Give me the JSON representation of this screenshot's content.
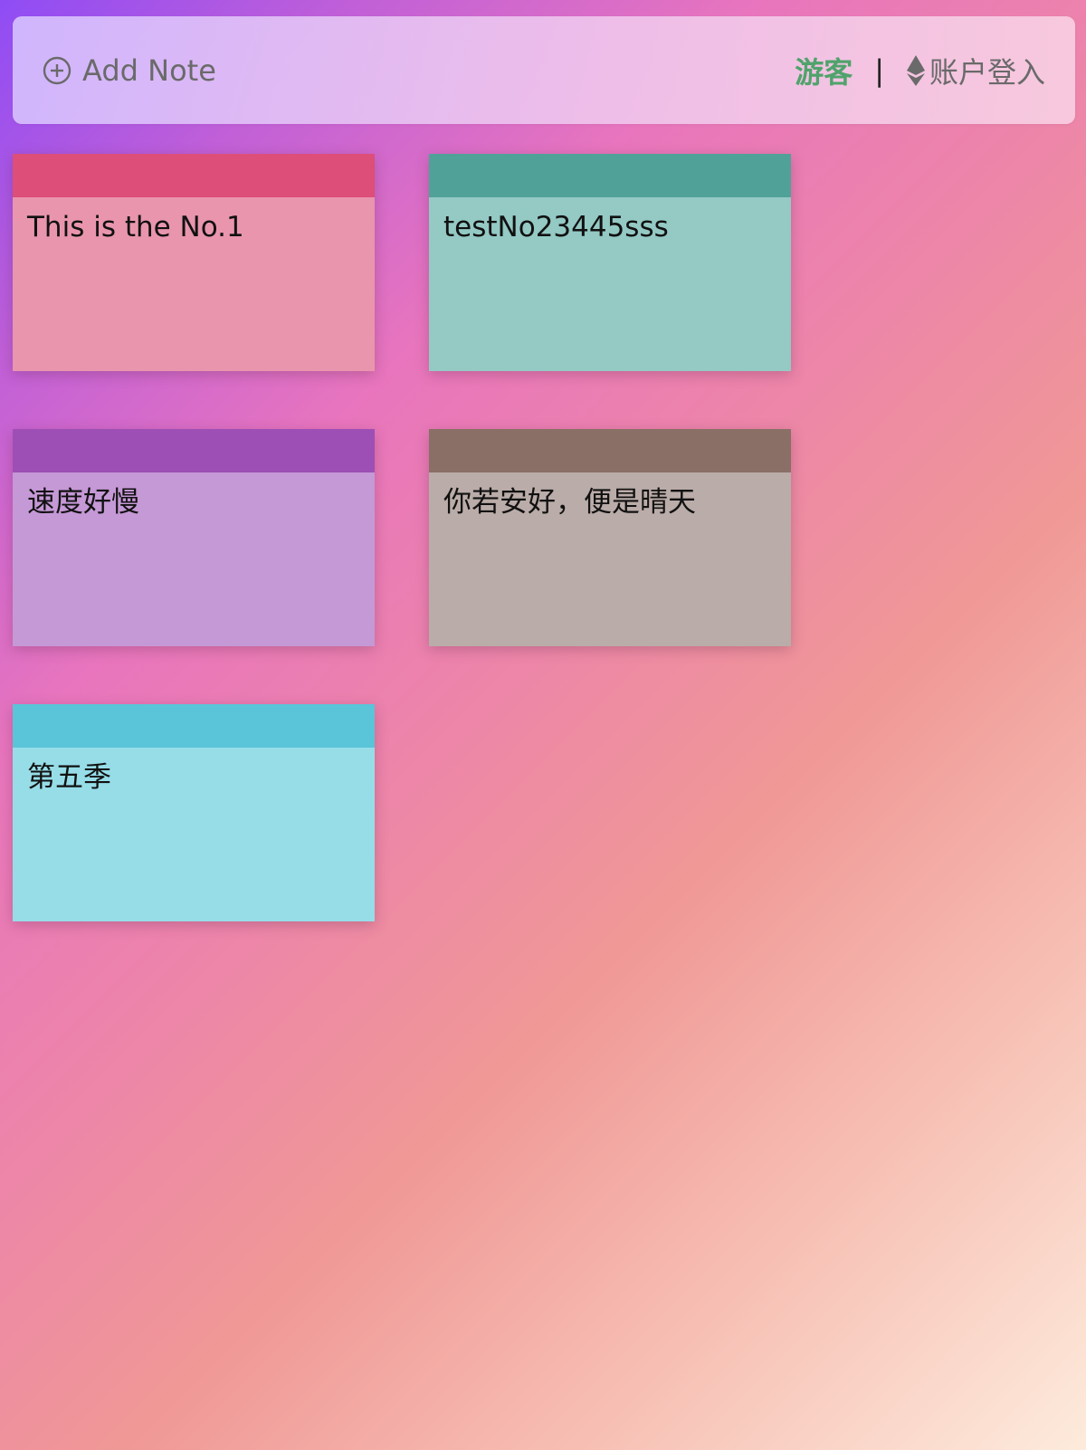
{
  "toolbar": {
    "add_note_label": "Add Note",
    "add_icon": "plus-circle-icon",
    "guest_label": "游客",
    "divider": "|",
    "login_icon": "ethereum-icon",
    "login_label": "账户登入",
    "guest_color": "#4fa36b"
  },
  "notes": [
    {
      "text": "This is the No.1",
      "header_color": "#dd4e78",
      "body_color": "#e995ae"
    },
    {
      "text": "testNo23445sss",
      "header_color": "#50a299",
      "body_color": "#94c9c4"
    },
    {
      "text": "速度好慢",
      "header_color": "#9e4fb5",
      "body_color": "#c598d6"
    },
    {
      "text": "你若安好，便是晴天",
      "header_color": "#8a6f66",
      "body_color": "#baaca8"
    },
    {
      "text": "第五季",
      "header_color": "#5ac4d8",
      "body_color": "#96dde8"
    }
  ]
}
